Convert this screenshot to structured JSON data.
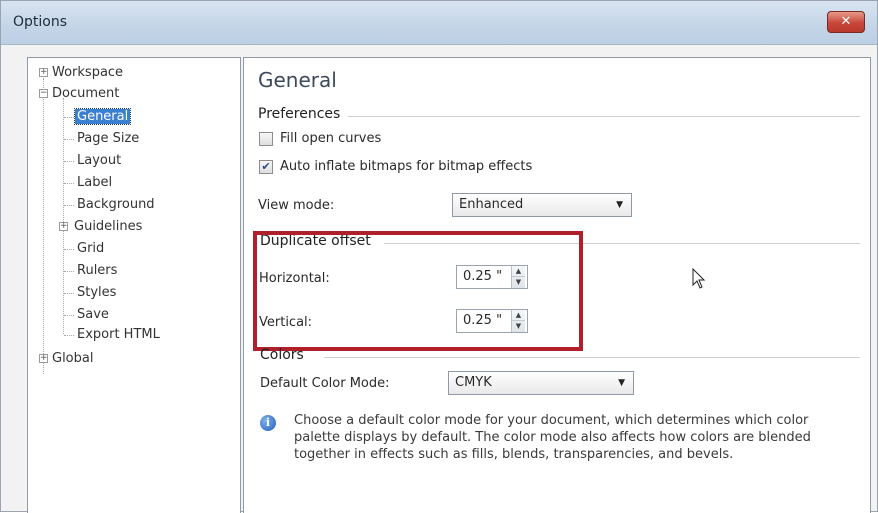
{
  "window": {
    "title": "Options",
    "close_glyph": "✕"
  },
  "tree": {
    "items": [
      {
        "label": "Workspace"
      },
      {
        "label": "Document"
      },
      {
        "label": "General"
      },
      {
        "label": "Page Size"
      },
      {
        "label": "Layout"
      },
      {
        "label": "Label"
      },
      {
        "label": "Background"
      },
      {
        "label": "Guidelines"
      },
      {
        "label": "Grid"
      },
      {
        "label": "Rulers"
      },
      {
        "label": "Styles"
      },
      {
        "label": "Save"
      },
      {
        "label": "Export HTML"
      },
      {
        "label": "Global"
      }
    ]
  },
  "panel": {
    "title": "General",
    "preferences": {
      "heading": "Preferences",
      "fill_open_curves": {
        "label": "Fill open curves",
        "checked": false
      },
      "auto_inflate": {
        "label": "Auto inflate bitmaps for bitmap effects",
        "checked": true
      },
      "view_mode_label": "View mode:",
      "view_mode_value": "Enhanced"
    },
    "duplicate_offset": {
      "heading": "Duplicate offset",
      "horizontal_label": "Horizontal:",
      "horizontal_value": "0.25 \"",
      "vertical_label": "Vertical:",
      "vertical_value": "0.25 \""
    },
    "colors": {
      "heading": "Colors",
      "default_mode_label": "Default Color Mode:",
      "default_mode_value": "CMYK",
      "info_text": "Choose a default color mode for your document, which determines which color palette displays by default. The color mode also affects how colors are blended together in effects such as fills, blends, transparencies, and bevels."
    }
  },
  "colors": {
    "highlight_border": "#b0202a",
    "selection": "#3a7fd0",
    "titlebar": "#c4d5e8"
  },
  "icons": {
    "close": "close-icon",
    "info": "info-icon",
    "cursor": "mouse-pointer-icon",
    "expand": "plus-icon",
    "collapse": "minus-icon",
    "dropdown": "chevron-down-icon"
  }
}
